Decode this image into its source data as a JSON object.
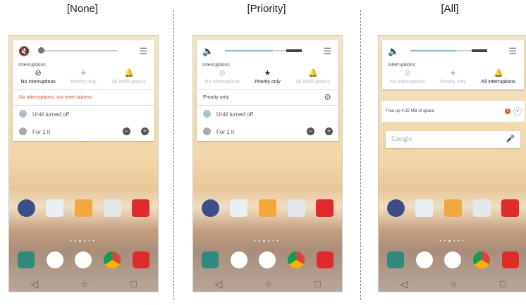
{
  "columns": [
    {
      "title": "[None]",
      "mode": "none",
      "volume_level": 0.05,
      "interruptions_label": "Interruptions",
      "options": [
        {
          "label": "No interruptions",
          "icon": "no-entry-icon",
          "selected": true
        },
        {
          "label": "Priority only",
          "icon": "star-icon",
          "selected": false
        },
        {
          "label": "All interruptions",
          "icon": "bell-icon",
          "selected": false
        }
      ],
      "note": "No interruptions, not even alarms",
      "radios": [
        "Until turned off",
        "For 1 h"
      ]
    },
    {
      "title": "[Priority]",
      "mode": "priority",
      "volume_level": 0.85,
      "interruptions_label": "Interruptions",
      "options": [
        {
          "label": "No interruptions",
          "icon": "no-entry-icon",
          "selected": false
        },
        {
          "label": "Priority only",
          "icon": "star-icon",
          "selected": true
        },
        {
          "label": "All interruptions",
          "icon": "bell-icon",
          "selected": false
        }
      ],
      "priority_header": "Priority only",
      "radios": [
        "Until turned off",
        "For 1 h"
      ]
    },
    {
      "title": "[All]",
      "mode": "all",
      "volume_level": 0.6,
      "interruptions_label": "Interruptions",
      "options": [
        {
          "label": "No interruptions",
          "icon": "no-entry-icon",
          "selected": false
        },
        {
          "label": "Priority only",
          "icon": "star-icon",
          "selected": false
        },
        {
          "label": "All interruptions",
          "icon": "bell-icon",
          "selected": true
        }
      ],
      "notification": "Free up 4.32 MB of space",
      "search_placeholder": "Google"
    }
  ],
  "home_apps": [
    {
      "icon": "apps-folder-icon",
      "color": "#3a4f8a"
    },
    {
      "icon": "play-store-icon",
      "color": "#e9eef3"
    },
    {
      "icon": "email-icon",
      "color": "#f0a73c"
    },
    {
      "icon": "camera-icon",
      "color": "#e3e7ea"
    },
    {
      "icon": "voicemail-icon",
      "color": "#e02b2b"
    }
  ],
  "dock_apps": [
    {
      "icon": "phone-icon",
      "color": "#2f8a7e"
    },
    {
      "icon": "contacts-icon",
      "color": "#ffffff"
    },
    {
      "icon": "apps-drawer-icon",
      "color": "#ffffff"
    },
    {
      "icon": "chrome-icon",
      "color": "#ffffff"
    },
    {
      "icon": "messaging-icon",
      "color": "#e02b2b"
    }
  ],
  "nav_icons": [
    "back-icon",
    "home-icon",
    "recents-icon"
  ],
  "colors": {
    "accent": "#6ec5d3",
    "warning": "#e8542b"
  }
}
